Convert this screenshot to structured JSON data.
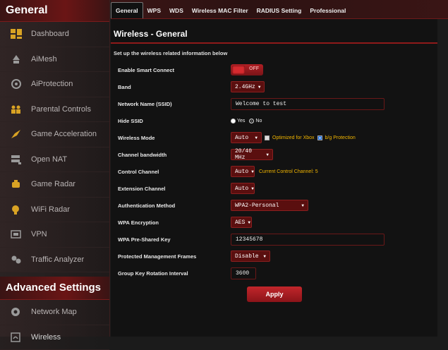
{
  "sidebar": {
    "general_title": "General",
    "items": [
      {
        "label": "Dashboard",
        "icon": "dashboard-icon"
      },
      {
        "label": "AiMesh",
        "icon": "mesh-icon"
      },
      {
        "label": "AiProtection",
        "icon": "shield-icon"
      },
      {
        "label": "Parental Controls",
        "icon": "family-icon"
      },
      {
        "label": "Game Acceleration",
        "icon": "rocket-icon"
      },
      {
        "label": "Open NAT",
        "icon": "server-icon"
      },
      {
        "label": "Game Radar",
        "icon": "radar-icon"
      },
      {
        "label": "WiFi Radar",
        "icon": "wifi-radar-icon"
      },
      {
        "label": "VPN",
        "icon": "vpn-icon"
      },
      {
        "label": "Traffic Analyzer",
        "icon": "analyzer-icon"
      }
    ],
    "advanced_title": "Advanced Settings",
    "advanced_items": [
      {
        "label": "Network Map",
        "icon": "globe-icon"
      },
      {
        "label": "Wireless",
        "icon": "wireless-icon"
      }
    ]
  },
  "tabs": [
    "General",
    "WPS",
    "WDS",
    "Wireless MAC Filter",
    "RADIUS Setting",
    "Professional"
  ],
  "page": {
    "title": "Wireless - General",
    "description": "Set up the wireless related information below"
  },
  "form": {
    "smart_connect": {
      "label": "Enable Smart Connect",
      "state": "OFF"
    },
    "band": {
      "label": "Band",
      "value": "2.4GHz"
    },
    "ssid": {
      "label": "Network Name (SSID)",
      "value": "Welcome to test"
    },
    "hide_ssid": {
      "label": "Hide SSID",
      "yes": "Yes",
      "no": "No",
      "selected": "No"
    },
    "wireless_mode": {
      "label": "Wireless Mode",
      "value": "Auto",
      "xbox_label": "Optimized for Xbox",
      "xbox_checked": false,
      "bg_label": "b/g Protection",
      "bg_checked": true
    },
    "channel_bandwidth": {
      "label": "Channel bandwidth",
      "value": "20/40 MHz"
    },
    "control_channel": {
      "label": "Control Channel",
      "value": "Auto",
      "hint": "Current Control Channel: 5"
    },
    "extension_channel": {
      "label": "Extension Channel",
      "value": "Auto"
    },
    "auth_method": {
      "label": "Authentication Method",
      "value": "WPA2-Personal"
    },
    "wpa_encryption": {
      "label": "WPA Encryption",
      "value": "AES"
    },
    "psk": {
      "label": "WPA Pre-Shared Key",
      "value": "12345678"
    },
    "pmf": {
      "label": "Protected Management Frames",
      "value": "Disable"
    },
    "gk_interval": {
      "label": "Group Key Rotation Interval",
      "value": "3600"
    }
  },
  "apply_label": "Apply",
  "colors": {
    "accent": "#b01f24",
    "warning": "#f0b400",
    "background": "#121212"
  }
}
